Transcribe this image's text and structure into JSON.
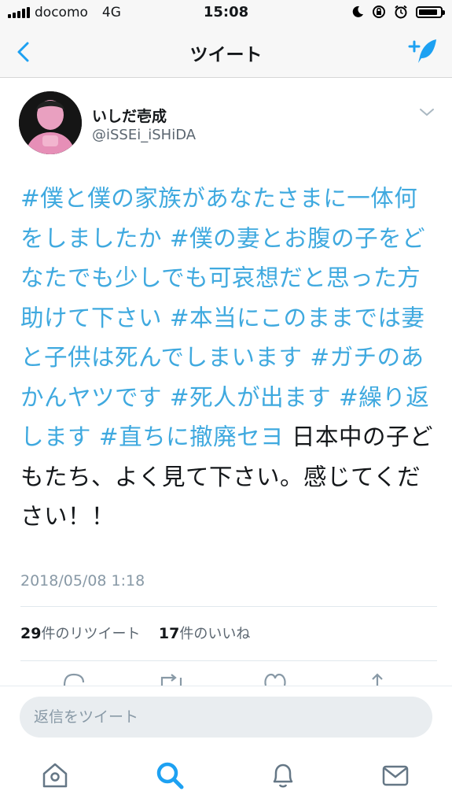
{
  "status_bar": {
    "carrier": "docomo",
    "network": "4G",
    "time": "15:08",
    "battery_level": 0.9
  },
  "nav": {
    "title": "ツイート",
    "back_icon": "chevron-left-icon",
    "compose_icon": "compose-tweet-icon",
    "accent_color": "#1da1f2"
  },
  "tweet": {
    "display_name": "いしだ壱成",
    "handle": "@iSSEi_iSHiDA",
    "hashtag_text": "#僕と僕の家族があなたさまに一体何をしましたか #僕の妻とお腹の子をどなたでも少しでも可哀想だと思った方助けて下さい #本当にこのままでは妻と子供は死んでしまいます #ガチのあかんヤツです #死人が出ます #繰り返します #直ちに撤廃セヨ",
    "plain_text": " 日本中の子どもたち、よく見て下さい。感じてください！！",
    "timestamp": "2018/05/08 1:18",
    "retweet_count": "29",
    "retweet_label": "件のリツイート",
    "like_count": "17",
    "like_label": "件のいいね",
    "hashtag_color": "#3fa9df"
  },
  "actions": [
    "reply-icon",
    "retweet-icon",
    "like-icon",
    "share-icon"
  ],
  "reply_bar": {
    "placeholder": "返信をツイート"
  },
  "tab_bar": {
    "tabs": [
      "home-icon",
      "search-icon",
      "notifications-icon",
      "messages-icon"
    ],
    "active": "search-icon"
  }
}
